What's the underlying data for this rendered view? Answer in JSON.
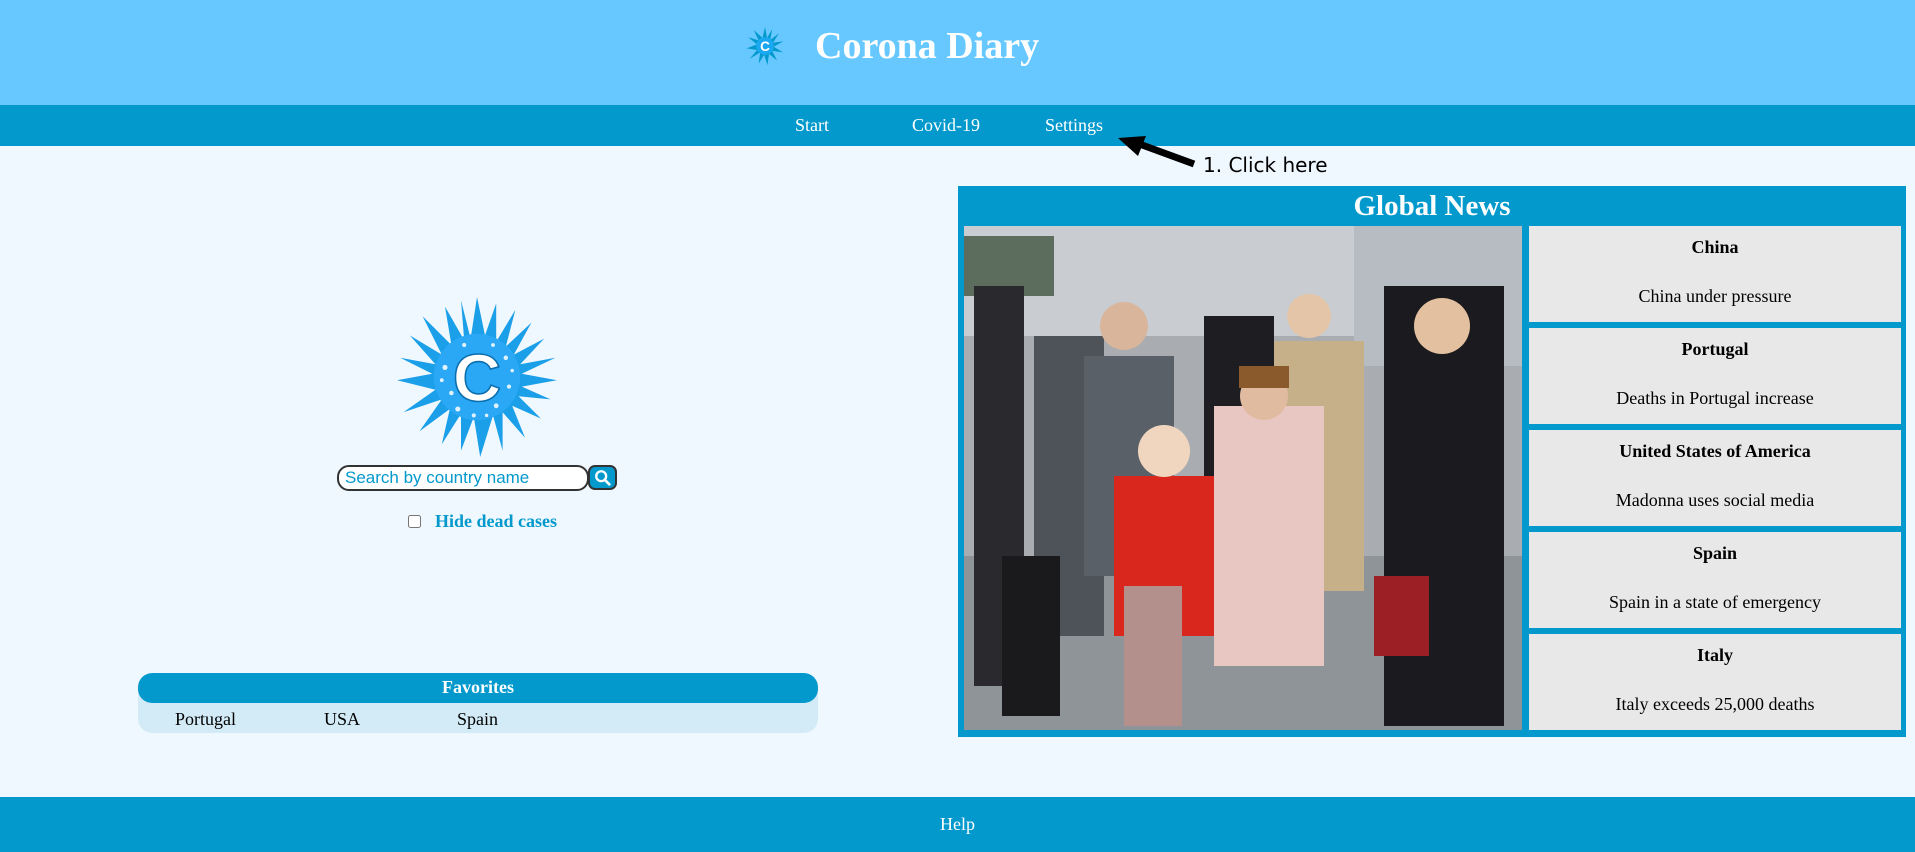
{
  "header": {
    "title": "Corona Diary"
  },
  "nav": {
    "items": [
      "Start",
      "Covid-19",
      "Settings"
    ]
  },
  "annotation": {
    "text": "1. Click here"
  },
  "search": {
    "placeholder": "Search by country name",
    "value": ""
  },
  "filter": {
    "label": "Hide dead cases",
    "checked": false
  },
  "favorites": {
    "title": "Favorites",
    "items": [
      "Portugal",
      "USA",
      "Spain"
    ]
  },
  "news": {
    "title": "Global News",
    "items": [
      {
        "country": "China",
        "headline": "China under pressure"
      },
      {
        "country": "Portugal",
        "headline": "Deaths in Portugal increase"
      },
      {
        "country": "United States of America",
        "headline": "Madonna uses social media"
      },
      {
        "country": "Spain",
        "headline": "Spain in a state of emergency"
      },
      {
        "country": "Italy",
        "headline": "Italy exceeds 25,000 deaths"
      }
    ]
  },
  "footer": {
    "help_label": "Help"
  },
  "colors": {
    "header_bg": "#66c8ff",
    "accent": "#0399cc",
    "page_bg": "#f0f8ff"
  }
}
